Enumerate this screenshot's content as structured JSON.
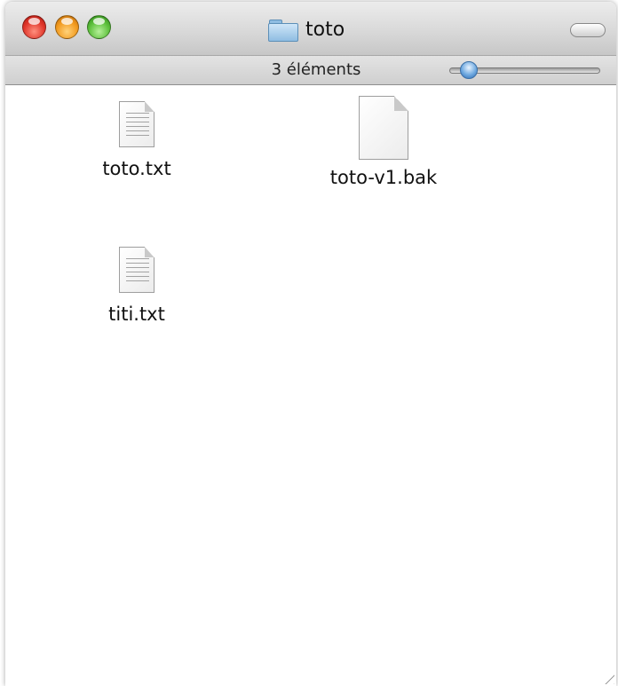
{
  "window": {
    "title": "toto",
    "status": "3 éléments"
  },
  "icons": {
    "close": "close-traffic-light",
    "minimize": "minimize-traffic-light",
    "zoom": "zoom-traffic-light",
    "folder": "folder-icon",
    "text_document": "text-document-icon",
    "blank_document": "blank-document-icon"
  },
  "icon_size_slider": {
    "level_fraction": 0.15
  },
  "files": [
    {
      "name": "toto.txt",
      "type": "text"
    },
    {
      "name": "toto-v1.bak",
      "type": "blank"
    },
    {
      "name": "titi.txt",
      "type": "text"
    }
  ],
  "colors": {
    "close": "#e0362b",
    "minimize": "#f29a1e",
    "zoom": "#5bbf3a",
    "folder": "#8fbde2"
  }
}
